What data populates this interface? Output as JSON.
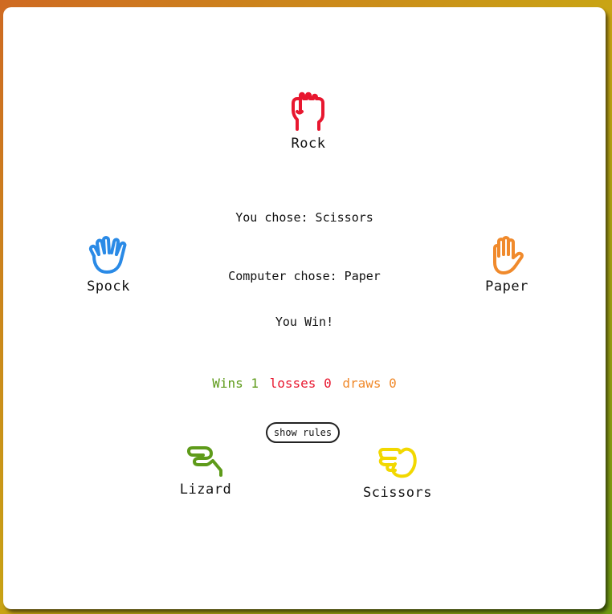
{
  "colors": {
    "rock": "#e8172f",
    "paper": "#f08a2c",
    "spock": "#2a8ae6",
    "lizard": "#5e9b1a",
    "scissors": "#f2d800",
    "wins": "#5e9b1a",
    "losses": "#e8172f",
    "draws": "#f08a2c"
  },
  "choices": {
    "rock": {
      "label": "Rock",
      "icon": "fist-icon"
    },
    "paper": {
      "label": "Paper",
      "icon": "open-hand-icon"
    },
    "spock": {
      "label": "Spock",
      "icon": "spock-hand-icon"
    },
    "lizard": {
      "label": "Lizard",
      "icon": "lizard-hand-icon"
    },
    "scissors": {
      "label": "Scissors",
      "icon": "scissors-hand-icon"
    }
  },
  "result": {
    "you_chose": "You chose: Scissors",
    "computer_chose": "Computer chose: Paper",
    "outcome": "You Win!"
  },
  "score": {
    "wins": "Wins 1",
    "losses": "losses 0",
    "draws": "draws 0"
  },
  "rules_button": "show rules"
}
